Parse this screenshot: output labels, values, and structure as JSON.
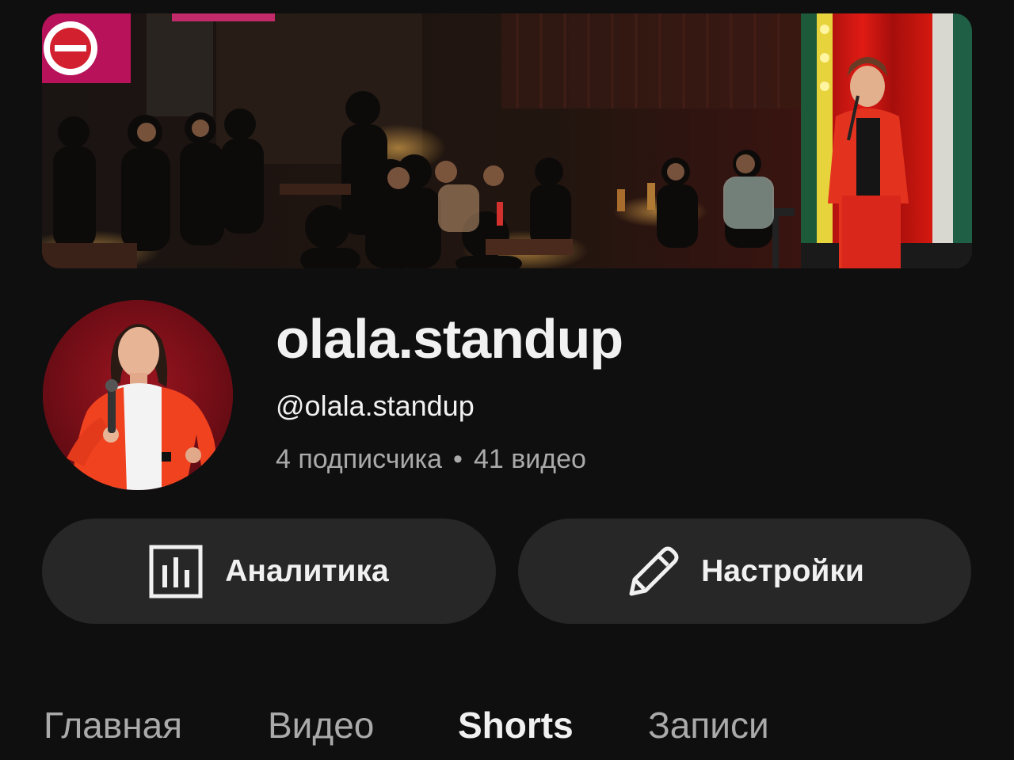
{
  "channel": {
    "name": "olala.standup",
    "handle": "@olala.standup",
    "subscribers": "4 подписчика",
    "separator": "•",
    "videos": "41 видео"
  },
  "actions": {
    "analytics_label": "Аналитика",
    "analytics_icon": "analytics-icon",
    "settings_label": "Настройки",
    "settings_icon": "pencil-icon"
  },
  "tabs": [
    {
      "label": "Главная",
      "active": false
    },
    {
      "label": "Видео",
      "active": false
    },
    {
      "label": "Shorts",
      "active": true
    },
    {
      "label": "Записи",
      "active": false
    }
  ],
  "colors": {
    "background": "#0f0f0f",
    "button_bg": "#272727",
    "text_primary": "#f1f1f1",
    "text_secondary": "#aaaaaa"
  }
}
